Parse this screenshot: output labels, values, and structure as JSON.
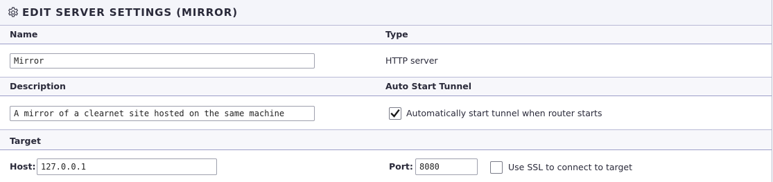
{
  "panel": {
    "title": "EDIT SERVER SETTINGS (MIRROR)",
    "title_icon": "gear-icon"
  },
  "sections": {
    "name_label": "Name",
    "type_label": "Type",
    "description_label": "Description",
    "auto_start_label": "Auto Start Tunnel",
    "target_label": "Target"
  },
  "fields": {
    "name_value": "Mirror",
    "type_value": "HTTP server",
    "description_value": "A mirror of a clearnet site hosted on the same machine",
    "auto_start_checked": true,
    "auto_start_text": "Automatically start tunnel when router starts",
    "host_label": "Host:",
    "host_value": "127.0.0.1",
    "port_label": "Port:",
    "port_value": "8080",
    "ssl_checked": false,
    "ssl_text": "Use SSL to connect to target"
  },
  "colors": {
    "section_border": "#9c9ec9",
    "header_bg": "#f7f7fb",
    "title_bg": "#f4f5fa"
  }
}
